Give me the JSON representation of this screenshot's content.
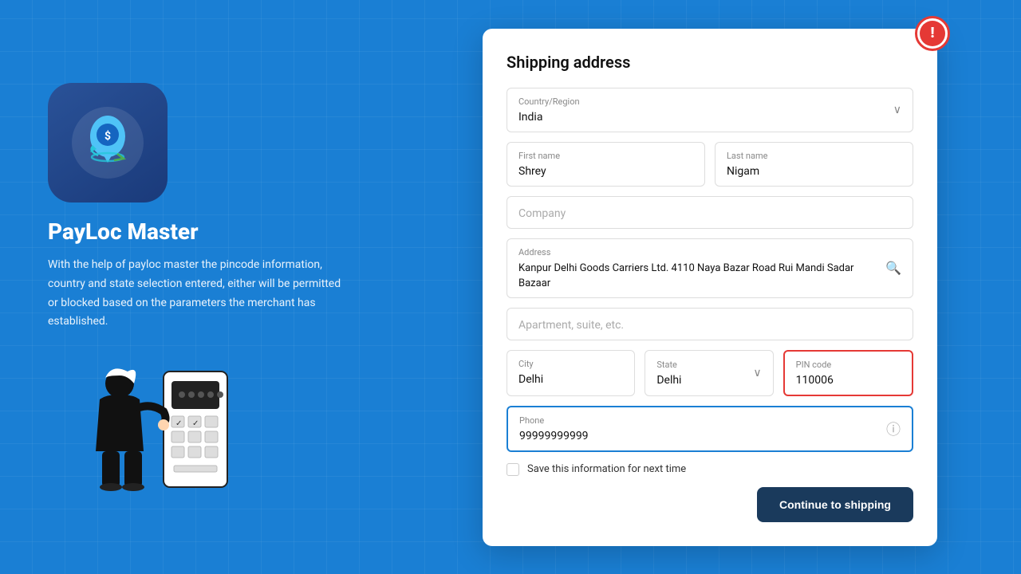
{
  "app": {
    "title": "PayLoc Master",
    "description": "With the help of payloc master the pincode information, country and state selection entered, either will be permitted or blocked based on the parameters the merchant has established."
  },
  "form": {
    "title": "Shipping address",
    "country_label": "Country/Region",
    "country_value": "India",
    "first_name_label": "First name",
    "first_name_value": "Shrey",
    "last_name_label": "Last name",
    "last_name_value": "Nigam",
    "company_label": "Company",
    "company_placeholder": "Company",
    "address_label": "Address",
    "address_value": "Kanpur Delhi Goods Carriers Ltd. 4110 Naya Bazar Road Rui Mandi Sadar Bazaar",
    "apartment_placeholder": "Apartment, suite, etc.",
    "city_label": "City",
    "city_value": "Delhi",
    "state_label": "State",
    "state_value": "Delhi",
    "pin_label": "PIN code",
    "pin_value": "110006",
    "phone_label": "Phone",
    "phone_value": "99999999999",
    "save_label": "Save this information for next time",
    "continue_label": "Continue to shipping"
  },
  "icons": {
    "chevron": "⌄",
    "search": "🔍",
    "alert": "!",
    "help": "?"
  }
}
